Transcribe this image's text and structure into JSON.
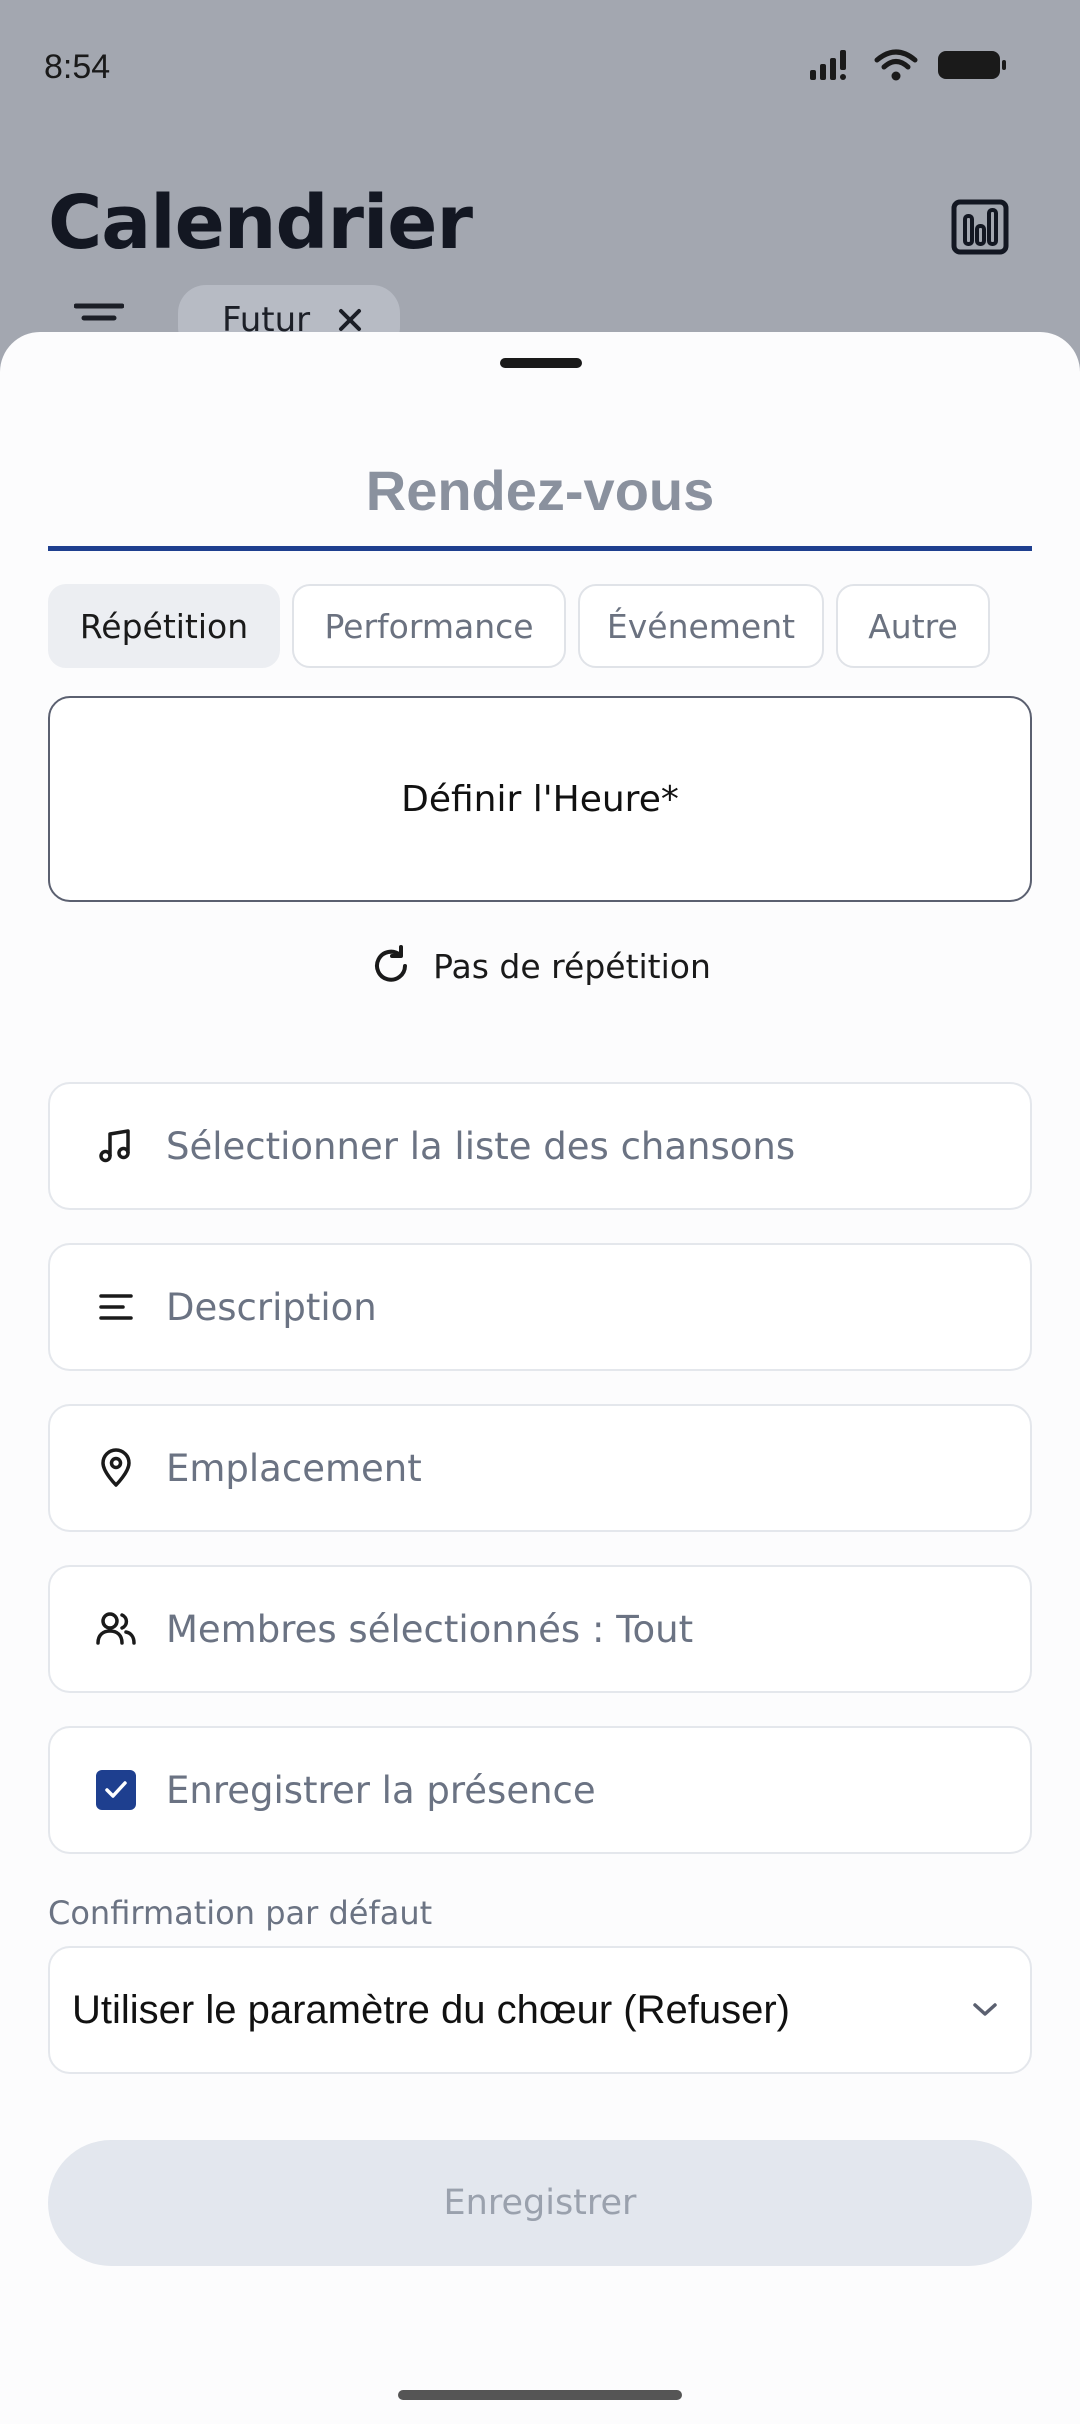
{
  "status_bar": {
    "time": "8:54"
  },
  "background": {
    "title": "Calendrier",
    "filter_chip": {
      "label": "Futur"
    }
  },
  "sheet": {
    "title": "Rendez-vous",
    "tabs": [
      {
        "label": "Répétition",
        "active": true
      },
      {
        "label": "Performance",
        "active": false
      },
      {
        "label": "Événement",
        "active": false
      },
      {
        "label": "Autre",
        "active": false
      }
    ],
    "time_button": "Définir l'Heure*",
    "repeat_label": "Pas de répétition",
    "fields": {
      "songs": "Sélectionner la liste des chansons",
      "description": "Description",
      "location": "Emplacement",
      "members": "Membres sélectionnés : Tout",
      "attendance": "Enregistrer la présence"
    },
    "attendance_checked": true,
    "confirmation": {
      "label": "Confirmation par défaut",
      "value": "Utiliser le paramètre du chœur (Refuser)"
    },
    "save_label": "Enregistrer"
  },
  "colors": {
    "accent": "#1e3f8f",
    "scrim": "#a3a7b0",
    "sheet_bg": "#fcfcfd",
    "disabled_button": "#e3e7ee"
  }
}
